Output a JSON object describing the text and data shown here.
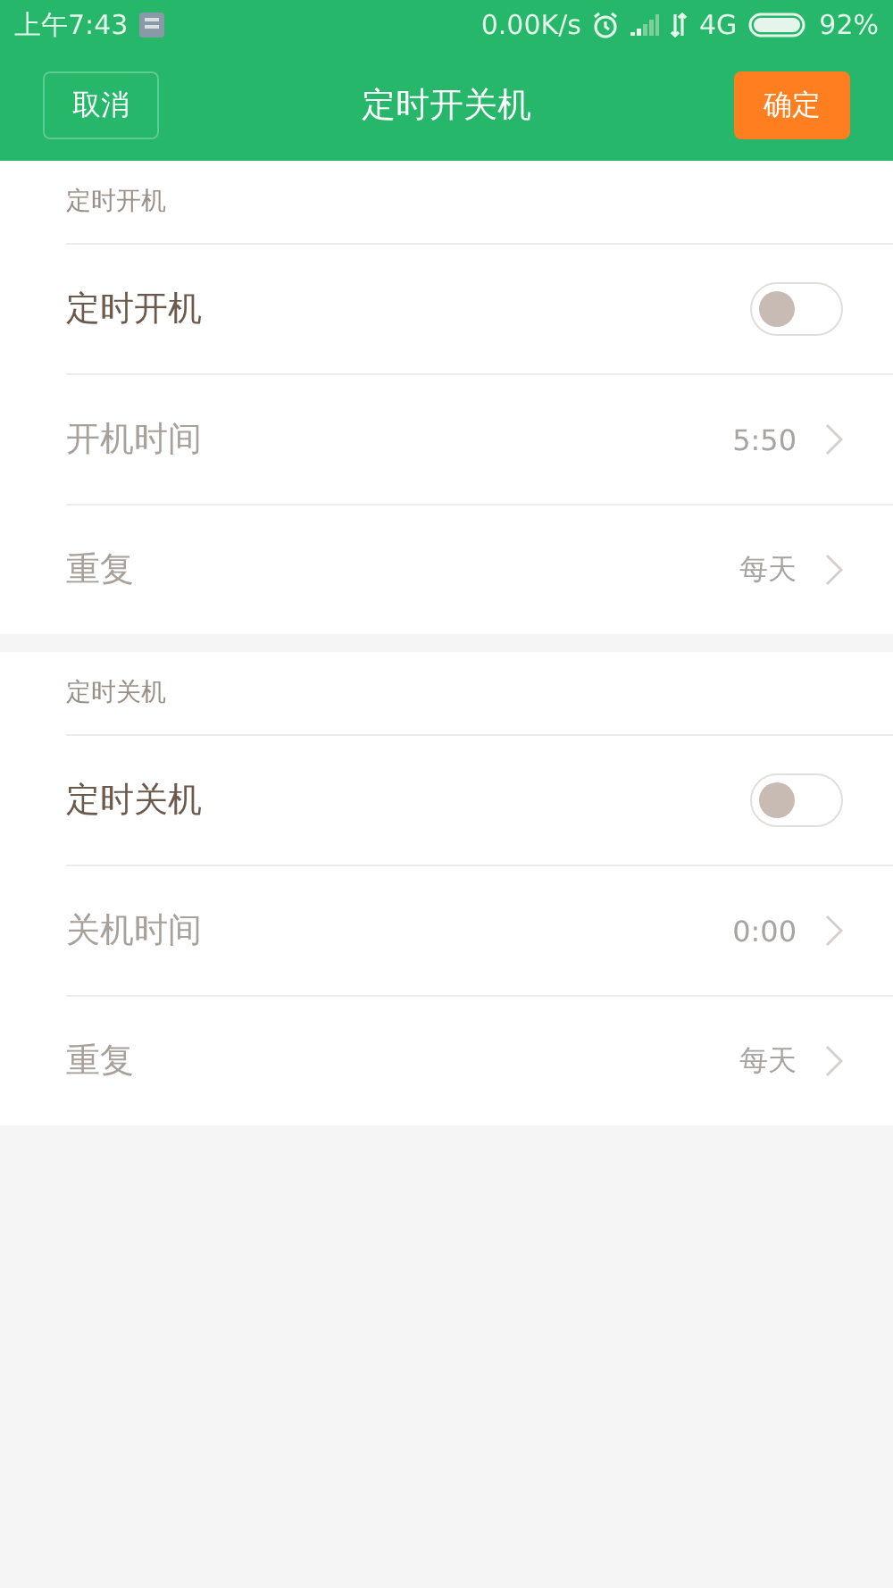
{
  "status_bar": {
    "time": "上午7:43",
    "network_speed": "0.00K/s",
    "network_type": "4G",
    "battery": "92%"
  },
  "header": {
    "title": "定时开关机",
    "cancel_button": "取消",
    "confirm_button": "确定"
  },
  "sections": [
    {
      "title": "定时开机",
      "rows": [
        {
          "kind": "switch",
          "label": "定时开机",
          "on": false,
          "disabled": false
        },
        {
          "kind": "nav",
          "label": "开机时间",
          "value": "5:50",
          "disabled": true
        },
        {
          "kind": "nav",
          "label": "重复",
          "value": "每天",
          "disabled": true
        }
      ]
    },
    {
      "title": "定时关机",
      "rows": [
        {
          "kind": "switch",
          "label": "定时关机",
          "on": false,
          "disabled": false
        },
        {
          "kind": "nav",
          "label": "关机时间",
          "value": "0:00",
          "disabled": true
        },
        {
          "kind": "nav",
          "label": "重复",
          "value": "每天",
          "disabled": true
        }
      ]
    }
  ]
}
